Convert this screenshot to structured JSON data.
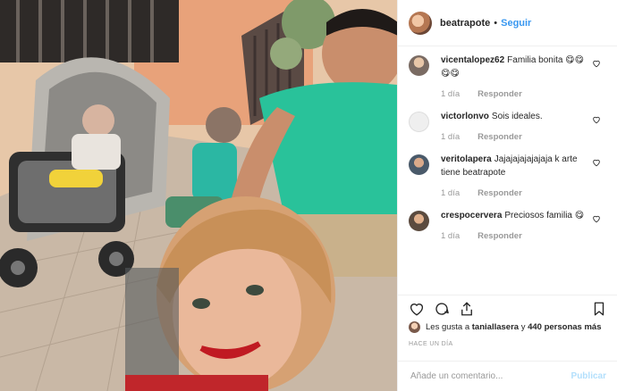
{
  "header": {
    "username": "beatrapote",
    "separator": "•",
    "follow": "Seguir"
  },
  "comments": [
    {
      "user": "vicentalopez62",
      "text": "Familia bonita 😋😋😋😋",
      "time": "1 día",
      "reply": "Responder"
    },
    {
      "user": "victorlonvo",
      "text": "Sois ideales.",
      "time": "1 día",
      "reply": "Responder"
    },
    {
      "user": "veritolapera",
      "text": "Jajajajajajajaja k arte tiene beatrapote",
      "time": "1 día",
      "reply": "Responder"
    },
    {
      "user": "crespocervera",
      "text": "Preciosos familia 😋",
      "time": "1 día",
      "reply": "Responder"
    }
  ],
  "likes": {
    "prefix": "Les gusta a",
    "user": "taniallasera",
    "middle": "y",
    "count": "440 personas más"
  },
  "timestamp": "HACE UN DÍA",
  "add_comment": {
    "placeholder": "Añade un comentario...",
    "publish": "Publicar"
  },
  "colors": {
    "link": "#3897f0",
    "publish_disabled": "#b2dffc",
    "muted": "#999999"
  }
}
